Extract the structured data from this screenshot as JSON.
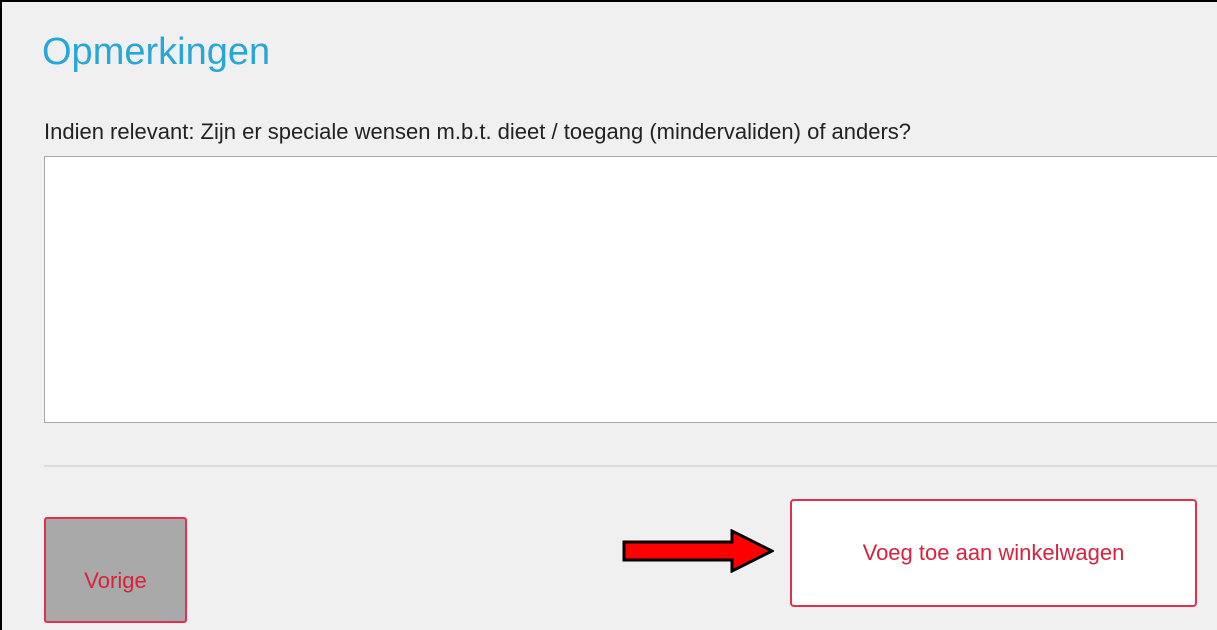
{
  "section": {
    "title": "Opmerkingen",
    "field_label": "Indien relevant: Zijn er speciale wensen m.b.t. dieet / toegang (mindervaliden) of anders?",
    "textarea_value": "",
    "textarea_placeholder": ""
  },
  "actions": {
    "back_label": "Vorige",
    "add_to_cart_label": "Voeg toe aan winkelwagen"
  },
  "annotation": {
    "icon": "arrow-right-icon",
    "color": "#ff0000"
  },
  "colors": {
    "title": "#27a7d8",
    "accent": "#e0304e",
    "button_text": "#d9213e",
    "back_button_bg": "#a9a9a9"
  }
}
